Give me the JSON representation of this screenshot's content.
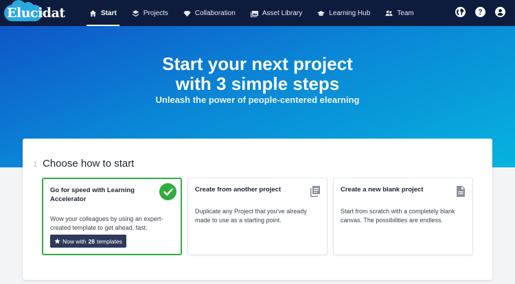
{
  "app": {
    "logo_text": "Elucidat"
  },
  "nav": {
    "items": [
      {
        "label": "Start",
        "icon": "home-icon",
        "active": true
      },
      {
        "label": "Projects",
        "icon": "layers-icon",
        "active": false
      },
      {
        "label": "Collaboration",
        "icon": "diamond-icon",
        "active": false
      },
      {
        "label": "Asset Library",
        "icon": "images-icon",
        "active": false
      },
      {
        "label": "Learning Hub",
        "icon": "graduation-cap-icon",
        "active": false
      },
      {
        "label": "Team",
        "icon": "people-icon",
        "active": false
      }
    ]
  },
  "top_icons": [
    "globe-icon",
    "help-icon",
    "account-icon"
  ],
  "hero": {
    "title_line1": "Start your next project",
    "title_line2": "with 3 simple steps",
    "subtitle": "Unleash the power of people-centered elearning"
  },
  "step": {
    "number": "1",
    "title": "Choose how to start"
  },
  "cards": [
    {
      "title": "Go for speed with Learning Accelerator",
      "description": "Wow your colleagues by using an expert-created template to get ahead, fast.",
      "selected": true,
      "badge": {
        "prefix": "Now with",
        "count": "28",
        "suffix": "templates",
        "icon": "star-icon"
      }
    },
    {
      "title": "Create from another project",
      "description": "Duplicate any Project that you've already made to use as a starting point.",
      "selected": false,
      "icon": "copy-documents-icon"
    },
    {
      "title": "Create a new blank project",
      "description": "Start from scratch with a completely blank canvas. The possibilities are endless.",
      "selected": false,
      "icon": "document-icon"
    }
  ],
  "colors": {
    "topbar": "#0d1b3d",
    "accent_green": "#2fae3e",
    "badge": "#2d3a5c",
    "hero_start": "#0f56c8",
    "hero_end": "#06b3df"
  }
}
